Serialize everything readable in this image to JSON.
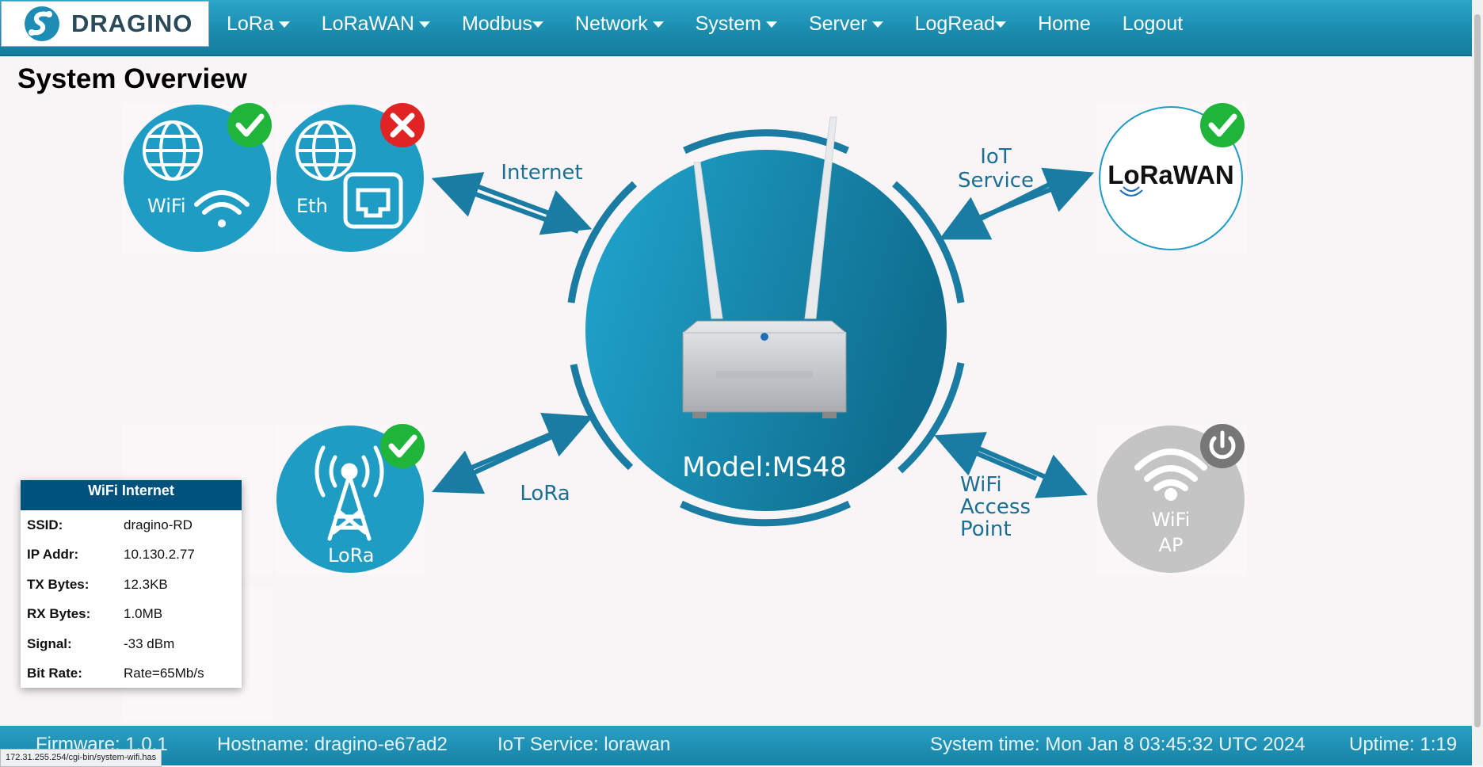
{
  "brand": {
    "logo_text": "DRAGINO"
  },
  "nav": [
    {
      "label": "LoRa",
      "dropdown": true
    },
    {
      "label": "LoRaWAN",
      "dropdown": true
    },
    {
      "label": "Modbus",
      "dropdown": true
    },
    {
      "label": "Network",
      "dropdown": true
    },
    {
      "label": "System",
      "dropdown": true
    },
    {
      "label": "Server",
      "dropdown": true
    },
    {
      "label": "LogRead",
      "dropdown": true
    },
    {
      "label": "Home",
      "dropdown": false
    },
    {
      "label": "Logout",
      "dropdown": false
    }
  ],
  "page_title": "System Overview",
  "diagram": {
    "wifi_label": "WiFi",
    "eth_label": "Eth",
    "lora_label": "LoRa",
    "wifi_ap_line1": "WiFi",
    "wifi_ap_line2": "AP",
    "lorawan_logo": "LoRaWAN",
    "internet_arrow": "Internet",
    "lora_arrow": "LoRa",
    "iot_arrow_line1": "IoT",
    "iot_arrow_line2": "Service",
    "ap_arrow_line1": "WiFi",
    "ap_arrow_line2": "Access",
    "ap_arrow_line3": "Point",
    "model": "Model:MS48",
    "status": {
      "wifi": "ok",
      "eth": "error",
      "lora": "ok",
      "lorawan": "ok",
      "wifi_ap": "off"
    },
    "colors": {
      "ok": "#1fb53a",
      "error": "#e02424",
      "off": "#777777",
      "primary": "#1e9cc4",
      "inactive": "#c4c4c4"
    }
  },
  "wifi_panel": {
    "title": "WiFi Internet",
    "rows": [
      {
        "label": "SSID:",
        "value": "dragino-RD"
      },
      {
        "label": "IP Addr:",
        "value": "10.130.2.77"
      },
      {
        "label": "TX Bytes:",
        "value": "12.3KB"
      },
      {
        "label": "RX Bytes:",
        "value": "1.0MB"
      },
      {
        "label": "Signal:",
        "value": "-33 dBm"
      },
      {
        "label": "Bit Rate:",
        "value": "Rate=65Mb/s"
      }
    ]
  },
  "footer": {
    "firmware": "Firmware: 1.0.1",
    "hostname": "Hostname: dragino-e67ad2",
    "iot_service": "IoT Service: lorawan",
    "system_time": "System time: Mon Jan 8 03:45:32 UTC 2024",
    "uptime": "Uptime:  1:19"
  },
  "status_url": "172.31.255.254/cgi-bin/system-wifi.has"
}
